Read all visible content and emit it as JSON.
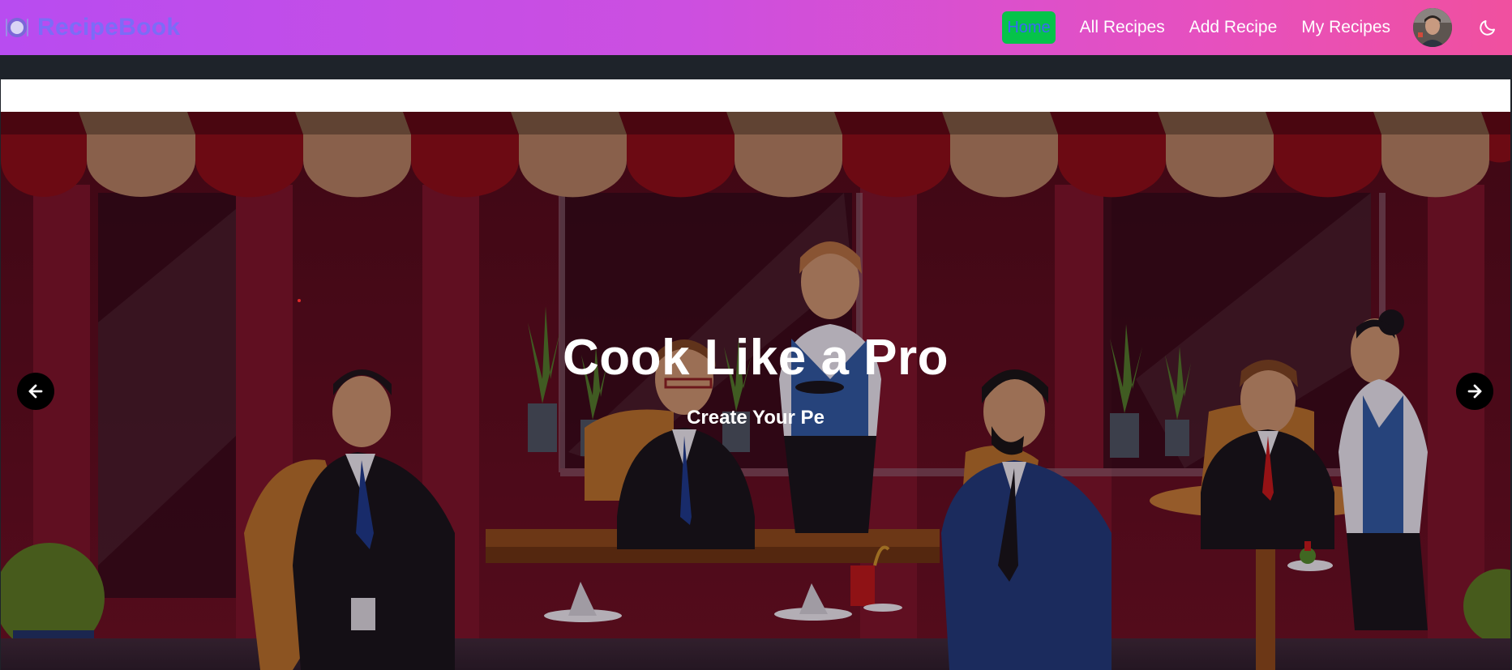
{
  "navbar": {
    "brand_name": "RecipeBook",
    "brand_icon": "plate-icon",
    "links": {
      "home": "Home",
      "all_recipes": "All Recipes",
      "add_recipe": "Add Recipe",
      "my_recipes": "My Recipes"
    },
    "theme_icon": "moon-icon",
    "colors": {
      "gradient_start": "#b84cf0",
      "gradient_end": "#f0509f",
      "brand_text": "#7c6cf7",
      "active_bg": "#06c34a",
      "active_text": "#3b67f5"
    }
  },
  "hero": {
    "title": "Cook Like a Pro",
    "subtitle": "Create Your Pe",
    "prev_icon": "arrow-left-icon",
    "next_icon": "arrow-right-icon"
  }
}
